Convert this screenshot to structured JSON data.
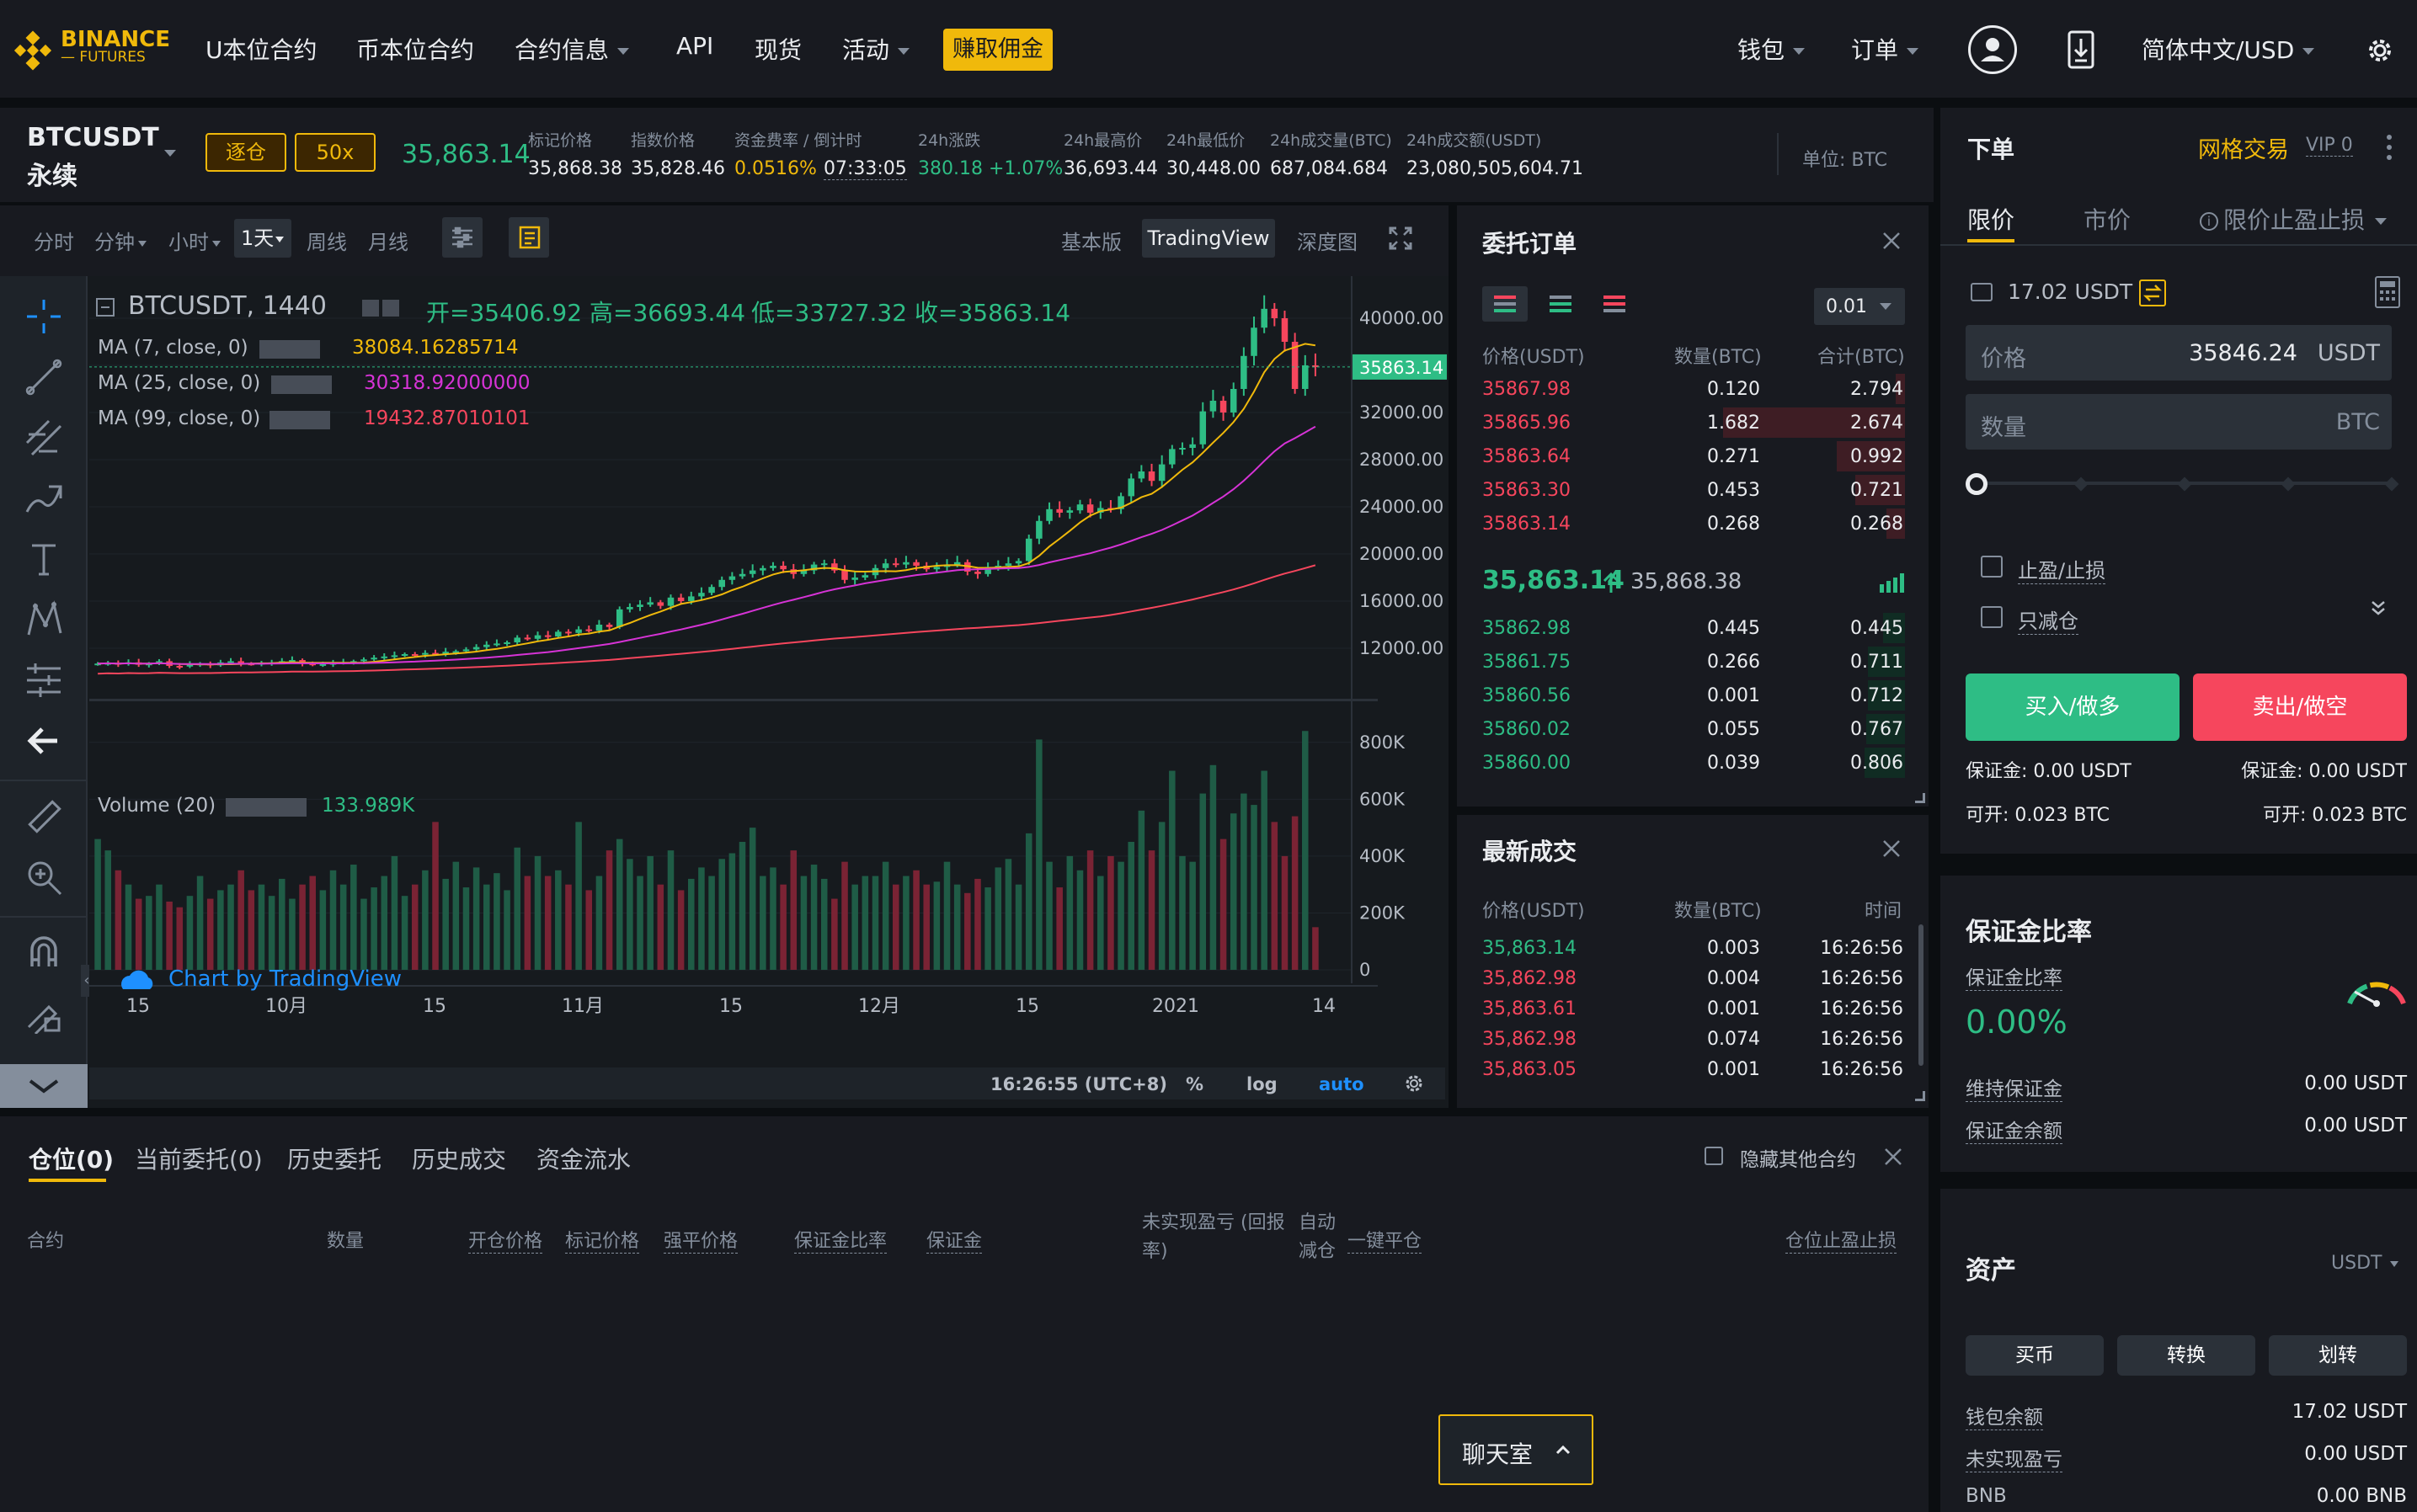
{
  "nav": {
    "logo_top": "BINANCE",
    "logo_bottom": "— FUTURES",
    "items": [
      "U本位合约",
      "币本位合约",
      "合约信息",
      "API",
      "现货",
      "活动"
    ],
    "earn": "赚取佣金",
    "wallet": "钱包",
    "orders": "订单",
    "lang": "简体中文/USD"
  },
  "ticker": {
    "symbol": "BTCUSDT",
    "type": "永续",
    "margin_mode": "逐仓",
    "leverage": "50x",
    "last_price": "35,863.14",
    "stats": [
      {
        "label": "标记价格",
        "value": "35,868.38"
      },
      {
        "label": "指数价格",
        "value": "35,828.46"
      },
      {
        "label": "资金费率 / 倒计时",
        "value": "0.0516%",
        "value2": "07:33:05"
      },
      {
        "label": "24h涨跌",
        "value": "380.18 +1.07%"
      },
      {
        "label": "24h最高价",
        "value": "36,693.44"
      },
      {
        "label": "24h最低价",
        "value": "30,448.00"
      },
      {
        "label": "24h成交量(BTC)",
        "value": "687,084.684"
      },
      {
        "label": "24h成交额(USDT)",
        "value": "23,080,505,604.71"
      }
    ],
    "unit": "单位: BTC"
  },
  "chart_toolbar": {
    "intervals": [
      "分时",
      "分钟",
      "小时",
      "1天",
      "周线",
      "月线"
    ],
    "views": [
      "基本版",
      "TradingView",
      "深度图"
    ]
  },
  "chart": {
    "legend_title": "BTCUSDT, 1440",
    "ohlc": {
      "o": "开=35406.92",
      "h": "高=36693.44",
      "l": "低=33727.32",
      "c": "收=35863.14"
    },
    "ma": [
      {
        "label": "MA (7, close, 0)",
        "value": "38084.16285714",
        "color": "#f0b90b"
      },
      {
        "label": "MA (25, close, 0)",
        "value": "30318.92000000",
        "color": "#d633d6"
      },
      {
        "label": "MA (99, close, 0)",
        "value": "19432.87010101",
        "color": "#f6465d"
      }
    ],
    "price_tag": "35863.14",
    "volume_label": "Volume (20)",
    "volume_value": "133.989K",
    "watermark": "Chart by TradingView",
    "time": "16:26:55 (UTC+8)",
    "pct": "%",
    "log": "log",
    "auto": "auto"
  },
  "chart_data": [
    {
      "type": "candlestick",
      "title": "BTCUSDT, 1440",
      "y_ticks": [
        "40000.00",
        "36000.00",
        "32000.00",
        "28000.00",
        "24000.00",
        "20000.00",
        "16000.00",
        "12000.00"
      ],
      "ylim": [
        9000,
        42000
      ],
      "x_ticks": [
        "15",
        "10月",
        "15",
        "11月",
        "15",
        "12月",
        "15",
        "2021",
        "14"
      ],
      "close_series": [
        10700,
        10750,
        10650,
        10800,
        10600,
        10700,
        10900,
        10500,
        10450,
        10600,
        10700,
        10550,
        10800,
        10900,
        10700,
        10650,
        10750,
        10800,
        10900,
        11000,
        10700,
        10600,
        10650,
        10750,
        10800,
        10900,
        11050,
        11200,
        11300,
        11400,
        11500,
        11450,
        11600,
        11500,
        11700,
        11750,
        11900,
        12100,
        12300,
        12400,
        12500,
        12900,
        12800,
        13100,
        13000,
        13400,
        13300,
        13600,
        13500,
        14000,
        13800,
        15300,
        15500,
        15700,
        15900,
        15600,
        16300,
        16000,
        16400,
        16700,
        17200,
        17800,
        18100,
        18300,
        18600,
        18800,
        19000,
        18700,
        18300,
        18600,
        19100,
        19200,
        18600,
        17800,
        18000,
        18200,
        18800,
        19200,
        19100,
        19300,
        19000,
        18700,
        18900,
        19100,
        19300,
        18500,
        18300,
        18900,
        19000,
        19200,
        19400,
        21300,
        22800,
        23800,
        23500,
        23700,
        24200,
        23500,
        23900,
        23800,
        24900,
        26400,
        27000,
        26200,
        27600,
        28900,
        29000,
        29300,
        32100,
        33000,
        32000,
        34000,
        36800,
        39200,
        40800,
        40000,
        38000,
        34000,
        36000,
        35863
      ]
    },
    {
      "type": "bar",
      "title": "Volume (20)",
      "y_ticks": [
        "800K",
        "600K",
        "400K",
        "200K",
        "0"
      ],
      "ylim": [
        0,
        900
      ],
      "values": [
        460,
        420,
        350,
        300,
        250,
        260,
        300,
        240,
        220,
        260,
        330,
        250,
        280,
        300,
        350,
        280,
        300,
        260,
        320,
        250,
        300,
        330,
        280,
        350,
        300,
        370,
        250,
        290,
        330,
        400,
        260,
        300,
        350,
        520,
        320,
        380,
        290,
        360,
        300,
        340,
        280,
        430,
        330,
        400,
        330,
        350,
        300,
        520,
        280,
        330,
        420,
        460,
        390,
        330,
        400,
        300,
        420,
        280,
        320,
        360,
        330,
        390,
        410,
        450,
        500,
        330,
        360,
        300,
        420,
        330,
        370,
        320,
        250,
        380,
        300,
        330,
        330,
        380,
        300,
        330,
        350,
        300,
        310,
        380,
        300,
        270,
        320,
        290,
        360,
        390,
        300,
        480,
        810,
        380,
        290,
        400,
        350,
        420,
        330,
        400,
        380,
        450,
        560,
        420,
        520,
        700,
        400,
        380,
        620,
        720,
        460,
        550,
        620,
        580,
        700,
        520,
        400,
        540,
        840,
        150
      ]
    }
  ],
  "orderbook": {
    "title": "委托订单",
    "precision": "0.01",
    "headers": [
      "价格(USDT)",
      "数量(BTC)",
      "合计(BTC)"
    ],
    "asks": [
      {
        "price": "35867.98",
        "amount": "0.120",
        "total": "2.794",
        "depth": 0.05
      },
      {
        "price": "35865.96",
        "amount": "1.682",
        "total": "2.674",
        "depth": 0.98
      },
      {
        "price": "35863.64",
        "amount": "0.271",
        "total": "0.992",
        "depth": 0.37
      },
      {
        "price": "35863.30",
        "amount": "0.453",
        "total": "0.721",
        "depth": 0.27
      },
      {
        "price": "35863.14",
        "amount": "0.268",
        "total": "0.268",
        "depth": 0.1
      }
    ],
    "last": "35,863.14",
    "mark": "35,868.38",
    "bids": [
      {
        "price": "35862.98",
        "amount": "0.445",
        "total": "0.445",
        "depth": 0.12
      },
      {
        "price": "35861.75",
        "amount": "0.266",
        "total": "0.711",
        "depth": 0.2
      },
      {
        "price": "35860.56",
        "amount": "0.001",
        "total": "0.712",
        "depth": 0.2
      },
      {
        "price": "35860.02",
        "amount": "0.055",
        "total": "0.767",
        "depth": 0.21
      },
      {
        "price": "35860.00",
        "amount": "0.039",
        "total": "0.806",
        "depth": 0.22
      }
    ]
  },
  "trades": {
    "title": "最新成交",
    "headers": [
      "价格(USDT)",
      "数量(BTC)",
      "时间"
    ],
    "rows": [
      {
        "price": "35,863.14",
        "amount": "0.003",
        "time": "16:26:56",
        "side": "buy"
      },
      {
        "price": "35,862.98",
        "amount": "0.004",
        "time": "16:26:56",
        "side": "sell"
      },
      {
        "price": "35,863.61",
        "amount": "0.001",
        "time": "16:26:56",
        "side": "sell"
      },
      {
        "price": "35,862.98",
        "amount": "0.074",
        "time": "16:26:56",
        "side": "sell"
      },
      {
        "price": "35,863.05",
        "amount": "0.001",
        "time": "16:26:56",
        "side": "sell"
      }
    ]
  },
  "positions": {
    "tabs": [
      "仓位(0)",
      "当前委托(0)",
      "历史委托",
      "历史成交",
      "资金流水"
    ],
    "hide_others": "隐藏其他合约",
    "columns": [
      "合约",
      "数量",
      "开仓价格",
      "标记价格",
      "强平价格",
      "保证金比率",
      "保证金",
      "未实现盈亏 (回报率)",
      "自动减仓",
      "一键平仓",
      "仓位止盈止损"
    ]
  },
  "order_form": {
    "title": "下单",
    "grid": "网格交易",
    "vip": "VIP 0",
    "tabs": [
      "限价",
      "市价",
      "限价止盈止损"
    ],
    "available": "17.02 USDT",
    "price_label": "价格",
    "price_value": "35846.24",
    "price_unit": "USDT",
    "qty_label": "数量",
    "qty_unit": "BTC",
    "tpsl": "止盈/止损",
    "reduce_only": "只减仓",
    "buy": "买入/做多",
    "sell": "卖出/做空",
    "buy_margin": "保证金: 0.00 USDT",
    "sell_margin": "保证金: 0.00 USDT",
    "buy_max": "可开: 0.023 BTC",
    "sell_max": "可开: 0.023 BTC"
  },
  "margin": {
    "title": "保证金比率",
    "ratio_label": "保证金比率",
    "ratio": "0.00%",
    "maint_label": "维持保证金",
    "maint": "0.00 USDT",
    "balance_label": "保证金余额",
    "balance": "0.00 USDT"
  },
  "assets": {
    "title": "资产",
    "currency": "USDT",
    "buttons": [
      "买币",
      "转换",
      "划转"
    ],
    "rows": [
      {
        "label": "钱包余额",
        "value": "17.02 USDT"
      },
      {
        "label": "未实现盈亏",
        "value": "0.00 USDT"
      },
      {
        "label": "BNB",
        "value": "0.00 BNB"
      }
    ]
  },
  "chat": "聊天室",
  "colors": {
    "up": "#2ebd85",
    "down": "#f6465d",
    "accent": "#f0b90b",
    "bg": "#0b0e11",
    "panel": "#181a20"
  }
}
